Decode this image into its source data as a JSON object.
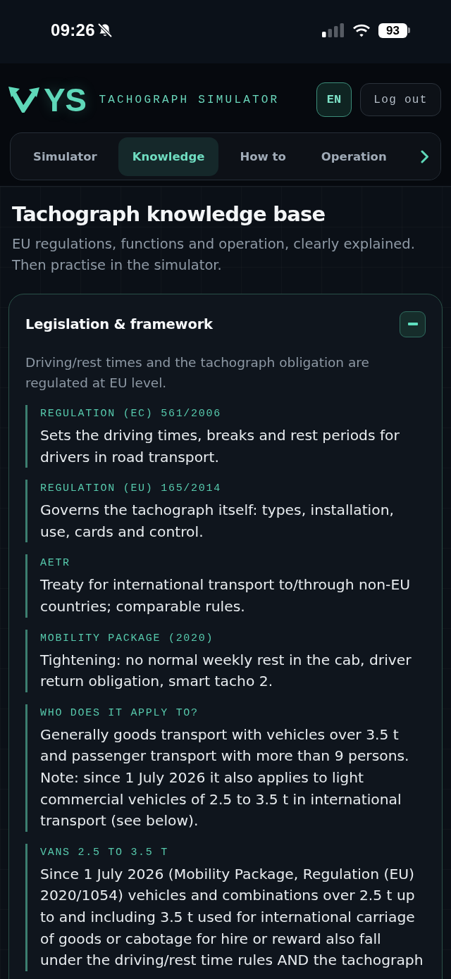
{
  "status_bar": {
    "time": "09:26",
    "battery": "93"
  },
  "header": {
    "logo_text": "YS",
    "product": "TACHOGRAPH SIMULATOR",
    "language_button": "EN",
    "logout_button": "Log out"
  },
  "tabs": [
    {
      "label": "Simulator",
      "selected": false
    },
    {
      "label": "Knowledge",
      "selected": true
    },
    {
      "label": "How to",
      "selected": false
    },
    {
      "label": "Operation",
      "selected": false
    }
  ],
  "page": {
    "title": "Tachograph knowledge base",
    "subtitle": "EU regulations, functions and operation, clearly explained. Then practise in the simulator."
  },
  "sections": [
    {
      "title": "Legislation & framework",
      "expanded": true,
      "intro": "Driving/rest times and the tachograph obligation are regulated at EU level.",
      "entries": [
        {
          "label": "REGULATION (EC) 561/2006",
          "text": "Sets the driving times, breaks and rest periods for drivers in road transport."
        },
        {
          "label": "REGULATION (EU) 165/2014",
          "text": "Governs the tachograph itself: types, installation, use, cards and control."
        },
        {
          "label": "AETR",
          "text": "Treaty for international transport to/through non-EU countries; comparable rules."
        },
        {
          "label": "MOBILITY PACKAGE (2020)",
          "text": "Tightening: no normal weekly rest in the cab, driver return obligation, smart tacho 2."
        },
        {
          "label": "WHO DOES IT APPLY TO?",
          "text": "Generally goods transport with vehicles over 3.5 t and passenger transport with more than 9 persons. Note: since 1 July 2026 it also applies to light commercial vehicles of 2.5 to 3.5 t in international transport (see below)."
        },
        {
          "label": "VANS 2.5 TO 3.5 T",
          "text": "Since 1 July 2026 (Mobility Package, Regulation (EU) 2020/1054) vehicles and combinations over 2.5 t up to and including 3.5 t used for international carriage of goods or cabotage for hire or reward also fall under the driving/rest time rules AND the tachograph"
        }
      ]
    }
  ]
}
